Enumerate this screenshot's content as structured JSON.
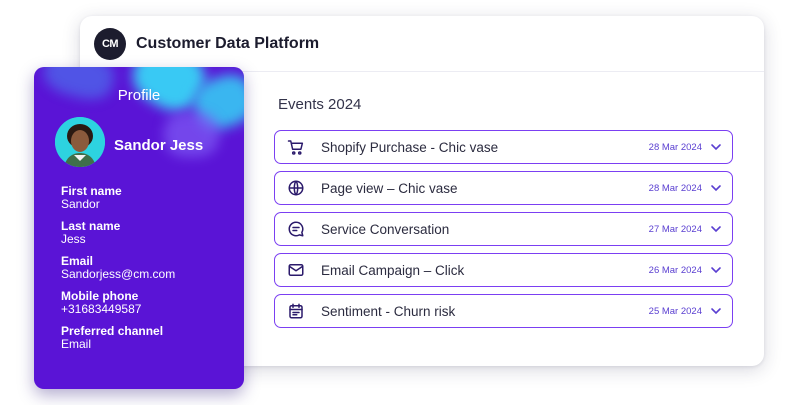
{
  "header": {
    "logo_text": "CM",
    "title": "Customer Data Platform"
  },
  "events_section": {
    "title": "Events 2024",
    "accent_color": "#7b3ff2",
    "items": [
      {
        "icon": "shopping-cart-icon",
        "label": "Shopify Purchase - Chic vase",
        "date": "28 Mar 2024"
      },
      {
        "icon": "globe-icon",
        "label": "Page view – Chic vase",
        "date": "28 Mar 2024"
      },
      {
        "icon": "chat-bubble-icon",
        "label": "Service Conversation",
        "date": "27 Mar 2024"
      },
      {
        "icon": "envelope-icon",
        "label": "Email Campaign – Click",
        "date": "26 Mar 2024"
      },
      {
        "icon": "calendar-icon",
        "label": "Sentiment  - Churn risk",
        "date": "25 Mar 2024"
      }
    ]
  },
  "profile": {
    "title": "Profile",
    "name": "Sandor Jess",
    "background_color": "#5a14d6",
    "fields": [
      {
        "label": "First name",
        "value": "Sandor"
      },
      {
        "label": "Last name",
        "value": "Jess"
      },
      {
        "label": "Email",
        "value": "Sandorjess@cm.com"
      },
      {
        "label": "Mobile phone",
        "value": "+31683449587"
      },
      {
        "label": "Preferred channel",
        "value": "Email"
      }
    ]
  }
}
